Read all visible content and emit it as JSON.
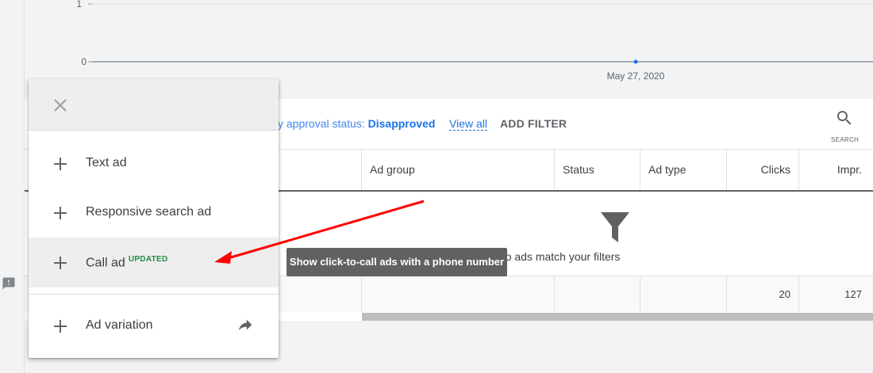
{
  "chart": {
    "y_ticks": [
      "1",
      "0"
    ],
    "x_label": "May 27, 2020",
    "line_color": "#5f6368",
    "point_color": "#1a73e8"
  },
  "filter_bar": {
    "filter_prefix": "cy approval status: ",
    "filter_value": "Disapproved",
    "view_all": "View all",
    "add_filter": "ADD FILTER",
    "search_label": "SEARCH",
    "search_icon": "search-icon"
  },
  "table": {
    "columns": [
      "Ad group",
      "Status",
      "Ad type",
      "Clicks",
      "Impr."
    ],
    "empty_message": "No ads match your filters",
    "empty_icon": "filter-funnel-icon",
    "totals": {
      "clicks": "20",
      "impr": "127"
    }
  },
  "menu": {
    "close_icon": "close-icon",
    "items": [
      {
        "label": "Text ad",
        "icon": "plus-icon"
      },
      {
        "label": "Responsive search ad",
        "icon": "plus-icon"
      },
      {
        "label": "Call ad",
        "badge": "UPDATED",
        "icon": "plus-icon"
      },
      {
        "label": "Ad variation",
        "icon": "plus-icon",
        "trailing_icon": "share-arrow-icon"
      }
    ]
  },
  "tooltip": {
    "text": "Show click-to-call ads with a phone number"
  },
  "colors": {
    "accent_blue": "#1a73e8",
    "badge_green": "#1e8e3e",
    "annotation_red": "#ff0000",
    "tooltip_bg": "#616161"
  }
}
